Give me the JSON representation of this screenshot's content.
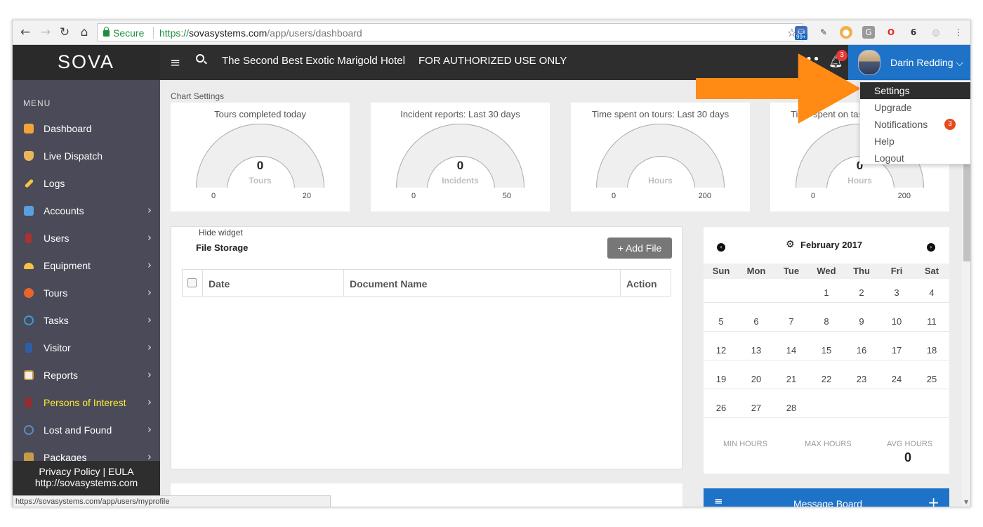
{
  "browser": {
    "secure_label": "Secure",
    "url_scheme": "https://",
    "url_host": "sovasystems.com",
    "url_path": "/app/users/dashboard",
    "extension_badge": "99+",
    "status_url": "https://sovasystems.com/app/users/myprofile"
  },
  "header": {
    "logo": "SOVA",
    "hotel_name": "The Second Best Exotic Marigold Hotel",
    "notice": "FOR AUTHORIZED USE ONLY",
    "notification_count": "3",
    "user_name": "Darin Redding",
    "user_chevron": "⌵",
    "accent_color": "#1e73c8"
  },
  "dropdown": {
    "items": [
      {
        "label": "Settings"
      },
      {
        "label": "Upgrade"
      },
      {
        "label": "Notifications",
        "badge": "3"
      },
      {
        "label": "Help"
      },
      {
        "label": "Logout"
      }
    ]
  },
  "sidebar": {
    "title": "MENU",
    "items": [
      {
        "label": "Dashboard",
        "icon": "home-icon"
      },
      {
        "label": "Live Dispatch",
        "icon": "shield-icon"
      },
      {
        "label": "Logs",
        "icon": "pencil-icon"
      },
      {
        "label": "Accounts",
        "icon": "building-icon"
      },
      {
        "label": "Users",
        "icon": "user-icon"
      },
      {
        "label": "Equipment",
        "icon": "hardhat-icon"
      },
      {
        "label": "Tours",
        "icon": "compass-icon"
      },
      {
        "label": "Tasks",
        "icon": "atom-icon"
      },
      {
        "label": "Visitor",
        "icon": "visitor-icon"
      },
      {
        "label": "Reports",
        "icon": "clipboard-icon"
      },
      {
        "label": "Persons of Interest",
        "icon": "person-icon"
      },
      {
        "label": "Lost and Found",
        "icon": "target-icon"
      },
      {
        "label": "Packages",
        "icon": "package-icon"
      }
    ],
    "footer_privacy": "Privacy Policy",
    "footer_divider": "|",
    "footer_eula": "EULA",
    "footer_url": "http://sovasystems.com"
  },
  "dashboard": {
    "chart_settings": "Chart Settings",
    "gauges": [
      {
        "title": "Tours completed today",
        "value": "0",
        "unit": "Tours",
        "min": "0",
        "max": "20"
      },
      {
        "title": "Incident reports: Last 30 days",
        "value": "0",
        "unit": "Incidents",
        "min": "0",
        "max": "50"
      },
      {
        "title": "Time spent on tours: Last 30 days",
        "value": "",
        "unit": "Hours",
        "min": "0",
        "max": "200"
      },
      {
        "title": "Time spent on tasks: Last 30 days",
        "value": "0",
        "unit": "Hours",
        "min": "0",
        "max": "200"
      }
    ],
    "file_storage": {
      "hide_widget": "Hide widget",
      "title": "File Storage",
      "add_file": "+ Add File",
      "columns": [
        "Date",
        "Document Name",
        "Action"
      ]
    },
    "calendar": {
      "prev_icon": "‹",
      "next_icon": "›",
      "gear_icon": "⚙",
      "month": "February 2017",
      "days_of_week": [
        "Sun",
        "Mon",
        "Tue",
        "Wed",
        "Thu",
        "Fri",
        "Sat"
      ],
      "weeks": [
        [
          "",
          "",
          "",
          "1",
          "2",
          "3",
          "4"
        ],
        [
          "5",
          "6",
          "7",
          "8",
          "9",
          "10",
          "11"
        ],
        [
          "12",
          "13",
          "14",
          "15",
          "16",
          "17",
          "18"
        ],
        [
          "19",
          "20",
          "21",
          "22",
          "23",
          "24",
          "25"
        ],
        [
          "26",
          "27",
          "28",
          "",
          "",
          "",
          ""
        ]
      ],
      "min_hours_label": "MIN HOURS",
      "max_hours_label": "MAX HOURS",
      "avg_hours_label": "AVG HOURS",
      "avg_hours_value": "0"
    },
    "message_board": {
      "title": "Message Board",
      "plus": "+"
    }
  }
}
